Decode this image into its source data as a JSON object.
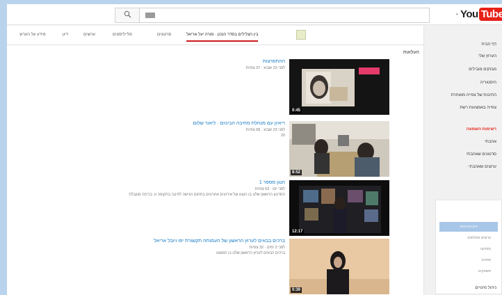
{
  "masthead": {
    "search_placeholder": "",
    "logo_you": "You",
    "logo_tube": "Tube"
  },
  "tabs": [
    {
      "label": "בין הצלילים בסדר הנכון · מורה יעל אריאל"
    },
    {
      "label": "סרטונים"
    },
    {
      "label": "פלייליסטים"
    },
    {
      "label": "ערוצים"
    },
    {
      "label": "דיון"
    },
    {
      "label": "מידע על הערוץ"
    }
  ],
  "section_title": "העלאות",
  "videos": [
    {
      "title": "ההתפרצות",
      "meta": "לפני 23 שבוע · 37 צפיות",
      "desc": "",
      "duration": "0:45"
    },
    {
      "title": "ריאיון עם מנהלת מחיבה הבינוים · ליאור שלום",
      "meta": "לפני 23 שבוע · 58 צפיות",
      "desc": "20",
      "duration": "8:52"
    },
    {
      "title": "הנגן מספר 1",
      "meta": "לפני יום · 63 צפיות",
      "desc": "הסרטון הראשון שלנו בו הוצגו של אירועים אחרונים בתחום הגישה לחינוך בתקופה זו, בכיתה מוגבלת",
      "duration": "12:17"
    },
    {
      "title": "ברכים בבאים לערוץ הראשון של העמותה תקשורת יפו ויובל אריאל",
      "meta": "לפני 2 ימים · 32 צפיות",
      "desc": "ברכים הבאים לערוץ הראשון שלנו בו תמצאו",
      "duration": "0:39"
    }
  ],
  "guide": {
    "items": [
      "דף הבית",
      "הערוץ שלי",
      "מבזקים מובילים",
      "היסטוריה",
      "התיבות של צפייה מאוחרת",
      "צפייה באמצעות רשת"
    ],
    "red_label": "רשימות השמעה",
    "items2": [
      "אהבתי",
      "סרטונים שאהבתי",
      "ערוצים שאהבתי"
    ],
    "box_head": "עיון בערוצים",
    "box_lines": [
      "ערוצים מומלצים",
      "מוסיקה",
      "ספורט",
      "משחקים"
    ],
    "bottom_item": "ניהול מינויים"
  },
  "colors": {
    "accent_red": "#cc181e",
    "link_blue": "#167ac6",
    "page_bg": "#b9d3ec"
  }
}
